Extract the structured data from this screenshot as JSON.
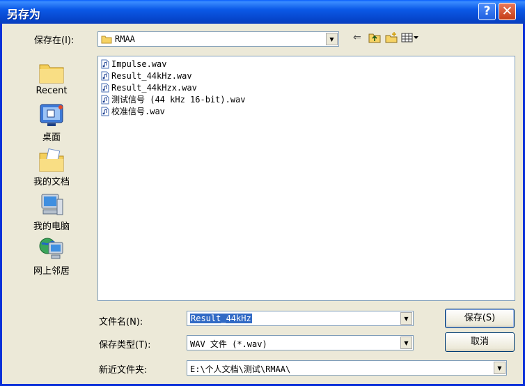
{
  "window": {
    "title": "另存为",
    "help_label": "?",
    "close_label": "✕"
  },
  "save_in": {
    "label": "保存在(I):",
    "value": "RMAA"
  },
  "toolbar": {
    "back_icon": "back-arrow-icon",
    "up_icon": "up-folder-icon",
    "new_folder_icon": "new-folder-icon",
    "view_icon": "view-menu-icon"
  },
  "places": [
    {
      "label": "Recent",
      "icon": "recent-folder-icon"
    },
    {
      "label": "桌面",
      "icon": "desktop-icon"
    },
    {
      "label": "我的文档",
      "icon": "my-documents-icon"
    },
    {
      "label": "我的电脑",
      "icon": "my-computer-icon"
    },
    {
      "label": "网上邻居",
      "icon": "network-icon"
    }
  ],
  "files": [
    "Impulse.wav",
    "Result_44kHz.wav",
    "Result_44kHzx.wav",
    "测试信号 (44 kHz 16-bit).wav",
    "校准信号.wav"
  ],
  "filename": {
    "label": "文件名(N):",
    "value": "Result_44kHz"
  },
  "filetype": {
    "label": "保存类型(T):",
    "value": "WAV 文件 (*.wav)"
  },
  "recent_folder": {
    "label": "新近文件夹:",
    "value": "E:\\个人文档\\测试\\RMAA\\"
  },
  "buttons": {
    "save": "保存(S)",
    "cancel": "取消"
  }
}
